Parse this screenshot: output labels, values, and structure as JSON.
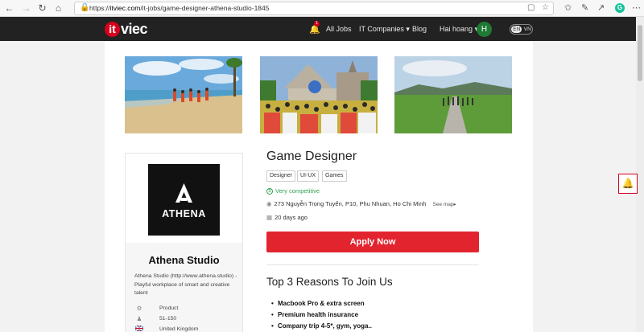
{
  "browser": {
    "url_prefix": "https://",
    "url_host": "itviec.com",
    "url_path": "/it-jobs/game-designer-athena-studio-1845",
    "icons": [
      "back-icon",
      "forward-icon",
      "refresh-icon",
      "home-icon",
      "lock-icon",
      "reader-icon",
      "favorite-star-icon",
      "favorites-icon",
      "pen-icon",
      "share-icon",
      "grammarly-icon",
      "more-icon"
    ],
    "grammarly_letter": "G"
  },
  "header": {
    "logo_it": "it",
    "logo_viec": "viec",
    "notification_count": "1",
    "nav": {
      "all_jobs": "All Jobs",
      "it_companies": "IT Companies",
      "blog": "Blog",
      "user_name": "Hai hoang"
    },
    "avatar_letter": "H",
    "lang_en": "EN",
    "lang_vn": "VN"
  },
  "company": {
    "logo_text": "ATHENA",
    "name": "Athena Studio",
    "description": "Athena Studio (http://www.athena.studio) - Playful workplace of smart and creative talent",
    "type": "Product",
    "size": "51-150",
    "country": "United Kingdom"
  },
  "job": {
    "title": "Game Designer",
    "tags": [
      "Designer",
      "UI-UX",
      "Games"
    ],
    "salary": "Very competitive",
    "address": "273 Nguyễn Trọng Tuyển, P10, Phu Nhuan, Ho Chi Minh",
    "see_map": "See map",
    "posted": "20 days ago",
    "apply_label": "Apply Now"
  },
  "reasons": {
    "title": "Top 3 Reasons To Join Us",
    "items": [
      "Macbook Pro & extra screen",
      "Premium health insurance",
      "Company trip 4-5*, gym, yoga.."
    ]
  },
  "colors": {
    "brand_red": "#e2242f",
    "header_bg": "#222222",
    "salary_green": "#2ea44f"
  }
}
